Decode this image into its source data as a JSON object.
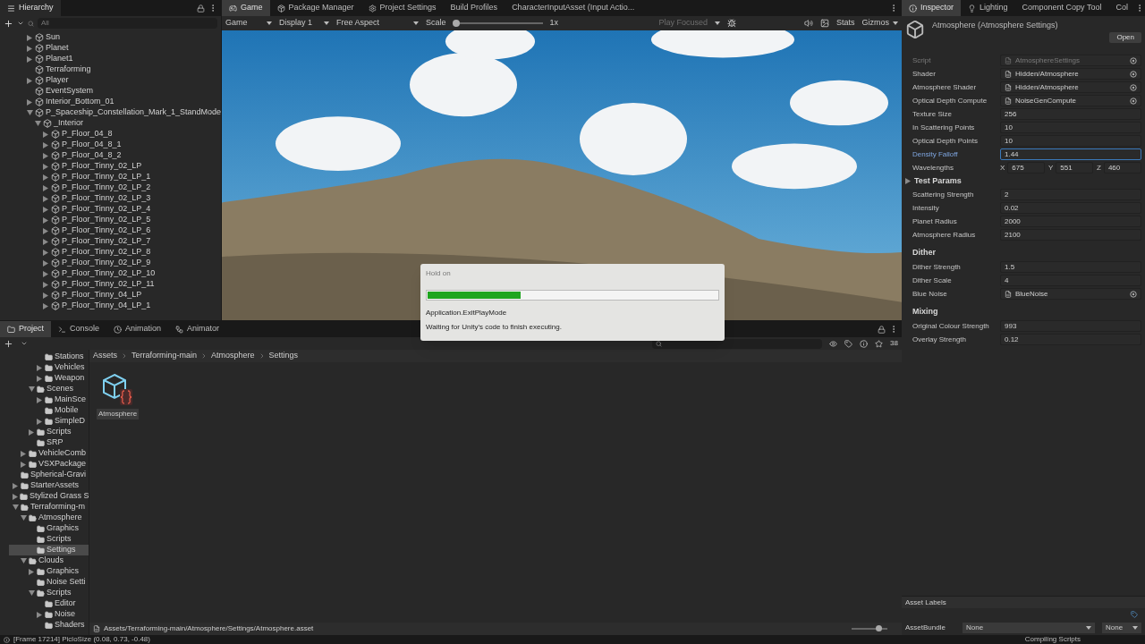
{
  "hierarchy": {
    "tab": "Hierarchy",
    "search": {
      "placeholder": "All"
    },
    "tree": [
      {
        "children": [
          {
            "name": "Sun",
            "expandable": true,
            "expanded": false
          },
          {
            "name": "Planet",
            "expandable": true,
            "expanded": false
          },
          {
            "name": "Planet1",
            "expandable": true,
            "expanded": false
          },
          {
            "name": "Terraforming",
            "expandable": false,
            "expanded": false
          },
          {
            "name": "Player",
            "expandable": true,
            "expanded": false
          },
          {
            "name": "EventSystem",
            "expandable": false,
            "expanded": false
          },
          {
            "name": "Interior_Bottom_01",
            "expandable": true,
            "expanded": false
          },
          {
            "name": "P_Spaceship_Constellation_Mark_1_StandMode",
            "expandable": true,
            "expanded": true,
            "children": [
              {
                "name": "_Interior",
                "expandable": true,
                "expanded": true,
                "children": [
                  {
                    "name": "P_Floor_04_8",
                    "expandable": true,
                    "expanded": false
                  },
                  {
                    "name": "P_Floor_04_8_1",
                    "expandable": true,
                    "expanded": false
                  },
                  {
                    "name": "P_Floor_04_8_2",
                    "expandable": true,
                    "expanded": false
                  },
                  {
                    "name": "P_Floor_Tinny_02_LP",
                    "expandable": true,
                    "expanded": false
                  },
                  {
                    "name": "P_Floor_Tinny_02_LP_1",
                    "expandable": true,
                    "expanded": false
                  },
                  {
                    "name": "P_Floor_Tinny_02_LP_2",
                    "expandable": true,
                    "expanded": false
                  },
                  {
                    "name": "P_Floor_Tinny_02_LP_3",
                    "expandable": true,
                    "expanded": false
                  },
                  {
                    "name": "P_Floor_Tinny_02_LP_4",
                    "expandable": true,
                    "expanded": false
                  },
                  {
                    "name": "P_Floor_Tinny_02_LP_5",
                    "expandable": true,
                    "expanded": false
                  },
                  {
                    "name": "P_Floor_Tinny_02_LP_6",
                    "expandable": true,
                    "expanded": false
                  },
                  {
                    "name": "P_Floor_Tinny_02_LP_7",
                    "expandable": true,
                    "expanded": false
                  },
                  {
                    "name": "P_Floor_Tinny_02_LP_8",
                    "expandable": true,
                    "expanded": false
                  },
                  {
                    "name": "P_Floor_Tinny_02_LP_9",
                    "expandable": true,
                    "expanded": false
                  },
                  {
                    "name": "P_Floor_Tinny_02_LP_10",
                    "expandable": true,
                    "expanded": false
                  },
                  {
                    "name": "P_Floor_Tinny_02_LP_11",
                    "expandable": true,
                    "expanded": false
                  },
                  {
                    "name": "P_Floor_Tinny_04_LP",
                    "expandable": true,
                    "expanded": false
                  },
                  {
                    "name": "P_Floor_Tinny_04_LP_1",
                    "expandable": true,
                    "expanded": false
                  }
                ]
              }
            ]
          }
        ]
      }
    ]
  },
  "center_tabs": [
    {
      "label": "Game",
      "selected": true
    },
    {
      "label": "Package Manager",
      "selected": false
    },
    {
      "label": "Project Settings",
      "selected": false
    },
    {
      "label": "Build Profiles",
      "selected": false
    },
    {
      "label": "CharacterInputAsset (Input Actio...",
      "selected": false
    }
  ],
  "game_toolbar": {
    "view": "Game",
    "display": "Display 1",
    "aspect": "Free Aspect",
    "scale_label": "Scale",
    "scale": {
      "level": 0.03
    },
    "scale_reading": "1x",
    "play_mode": "Play Focused",
    "stats": "Stats",
    "gizmos": "Gizmos"
  },
  "dialog": {
    "title": "Hold on",
    "progress": {
      "level": 0.32
    },
    "task": "Application.ExitPlayMode",
    "message": "Waiting for Unity's code to finish executing."
  },
  "bottom_tabs": [
    {
      "label": "Project",
      "selected": true
    },
    {
      "label": "Console",
      "selected": false
    },
    {
      "label": "Animation",
      "selected": false
    },
    {
      "label": "Animator",
      "selected": false
    }
  ],
  "project": {
    "tree": [
      {
        "children": [
          {
            "children": [
              {
                "children": [
                  {
                    "name": "Stations",
                    "expandable": false,
                    "expanded": false,
                    "selected": false
                  },
                  {
                    "name": "Vehicles",
                    "expandable": true,
                    "expanded": false,
                    "selected": false
                  },
                  {
                    "name": "Weapon",
                    "expandable": true,
                    "expanded": false,
                    "selected": false
                  }
                ]
              },
              {
                "name": "Scenes",
                "expandable": true,
                "expanded": true,
                "selected": false,
                "children": [
                  {
                    "name": "MainSce",
                    "expandable": true,
                    "expanded": false,
                    "selected": false
                  },
                  {
                    "name": "Mobile",
                    "expandable": false,
                    "expanded": false,
                    "selected": false
                  },
                  {
                    "name": "SimpleD",
                    "expandable": true,
                    "expanded": false,
                    "selected": false
                  }
                ]
              },
              {
                "name": "Scripts",
                "expandable": true,
                "expanded": false,
                "selected": false
              },
              {
                "name": "SRP",
                "expandable": false,
                "expanded": false,
                "selected": false
              }
            ]
          },
          {
            "name": "VehicleComb",
            "expandable": true,
            "expanded": false,
            "selected": false
          },
          {
            "name": "VSXPackage",
            "expandable": true,
            "expanded": false,
            "selected": false
          }
        ]
      },
      {
        "name": "Spherical-Gravi",
        "expandable": false,
        "expanded": false,
        "selected": false
      },
      {
        "name": "StarterAssets",
        "expandable": true,
        "expanded": false,
        "selected": false
      },
      {
        "name": "Stylized Grass S",
        "expandable": true,
        "expanded": false,
        "selected": false
      },
      {
        "name": "Terraforming-m",
        "expandable": true,
        "expanded": true,
        "selected": false,
        "children": [
          {
            "name": "Atmosphere",
            "expandable": true,
            "expanded": true,
            "selected": false,
            "children": [
              {
                "name": "Graphics",
                "expandable": false,
                "expanded": false,
                "selected": false
              },
              {
                "name": "Scripts",
                "expandable": false,
                "expanded": false,
                "selected": false
              },
              {
                "name": "Settings",
                "expandable": false,
                "expanded": false,
                "selected": true
              }
            ]
          },
          {
            "name": "Clouds",
            "expandable": true,
            "expanded": true,
            "selected": false,
            "children": [
              {
                "name": "Graphics",
                "expandable": true,
                "expanded": false,
                "selected": false
              },
              {
                "name": "Noise Setti",
                "expandable": false,
                "expanded": false,
                "selected": false
              },
              {
                "name": "Scripts",
                "expandable": true,
                "expanded": true,
                "selected": false,
                "children": [
                  {
                    "name": "Editor",
                    "expandable": false,
                    "expanded": false,
                    "selected": false
                  },
                  {
                    "name": "Noise",
                    "expandable": true,
                    "expanded": false,
                    "selected": false
                  },
                  {
                    "name": "Shaders",
                    "expandable": false,
                    "expanded": false,
                    "selected": false
                  }
                ]
              }
            ]
          }
        ]
      }
    ],
    "breadcrumb": [
      "Assets",
      "Terraforming-main",
      "Atmosphere",
      "Settings"
    ],
    "hidden_count": "38",
    "assets": [
      {
        "name": "Atmosphere"
      }
    ],
    "footer_path": "Assets/Terraforming-main/Atmosphere/Settings/Atmosphere.asset",
    "zoom": {
      "level": 0.75
    }
  },
  "inspector": {
    "tabs": [
      {
        "label": "Inspector",
        "selected": true
      },
      {
        "label": "Lighting",
        "selected": false
      },
      {
        "label": "Component Copy Tool",
        "selected": false
      },
      {
        "label": "Col",
        "selected": false
      }
    ],
    "title": "Atmosphere (Atmosphere Settings)",
    "open_button": "Open",
    "rows": [
      {
        "kind": "object",
        "label": "Script",
        "value": "AtmosphereSettings",
        "disabled": true,
        "focused": false
      },
      {
        "kind": "object",
        "label": "Shader",
        "value": "Hidden/Atmosphere",
        "disabled": false,
        "focused": false
      },
      {
        "kind": "object",
        "label": "Atmosphere Shader",
        "value": "Hidden/Atmosphere",
        "disabled": false,
        "focused": false
      },
      {
        "kind": "object",
        "label": "Optical Depth Compute",
        "value": "NoiseGenCompute",
        "disabled": false,
        "focused": false
      },
      {
        "kind": "field",
        "label": "Texture Size",
        "value": "256",
        "disabled": false,
        "focused": false
      },
      {
        "kind": "field",
        "label": "In Scattering Points",
        "value": "10",
        "disabled": false,
        "focused": false
      },
      {
        "kind": "field",
        "label": "Optical Depth Points",
        "value": "10",
        "disabled": false,
        "focused": false
      },
      {
        "kind": "field",
        "label": "Density Falloff",
        "value": "1.44",
        "disabled": false,
        "focused": true
      },
      {
        "kind": "vector",
        "label": "Wavelengths",
        "components": [
          {
            "axis": "X",
            "value": "675"
          },
          {
            "axis": "Y",
            "value": "551"
          },
          {
            "axis": "Z",
            "value": "460"
          }
        ],
        "disabled": false,
        "focused": false
      },
      {
        "kind": "foldout",
        "label": "Test Params",
        "expanded": false
      },
      {
        "kind": "field",
        "label": "Scattering Strength",
        "value": "2",
        "disabled": false,
        "focused": false
      },
      {
        "kind": "field",
        "label": "Intensity",
        "value": "0.02",
        "disabled": false,
        "focused": false
      },
      {
        "kind": "field",
        "label": "Planet Radius",
        "value": "2000",
        "disabled": false,
        "focused": false
      },
      {
        "kind": "field",
        "label": "Atmosphere Radius",
        "value": "2100",
        "disabled": false,
        "focused": false
      },
      {
        "kind": "heading",
        "label": "Dither"
      },
      {
        "kind": "field",
        "label": "Dither Strength",
        "value": "1.5",
        "disabled": false,
        "focused": false
      },
      {
        "kind": "field",
        "label": "Dither Scale",
        "value": "4",
        "disabled": false,
        "focused": false
      },
      {
        "kind": "object",
        "label": "Blue Noise",
        "value": "BlueNoise",
        "disabled": false,
        "focused": false
      },
      {
        "kind": "heading",
        "label": "Mixing"
      },
      {
        "kind": "field",
        "label": "Original Colour Strength",
        "value": "993",
        "disabled": false,
        "focused": false
      },
      {
        "kind": "field",
        "label": "Overlay Strength",
        "value": "0.12",
        "disabled": false,
        "focused": false
      }
    ],
    "asset_labels": "Asset Labels",
    "asset_bundle": {
      "label": "AssetBundle",
      "name": "None",
      "variant": "None"
    }
  },
  "status_bar": {
    "message": "[Frame 17214] PicloSize (0.08, 0.73, -0.48)",
    "progress": "Compiling Scripts"
  }
}
